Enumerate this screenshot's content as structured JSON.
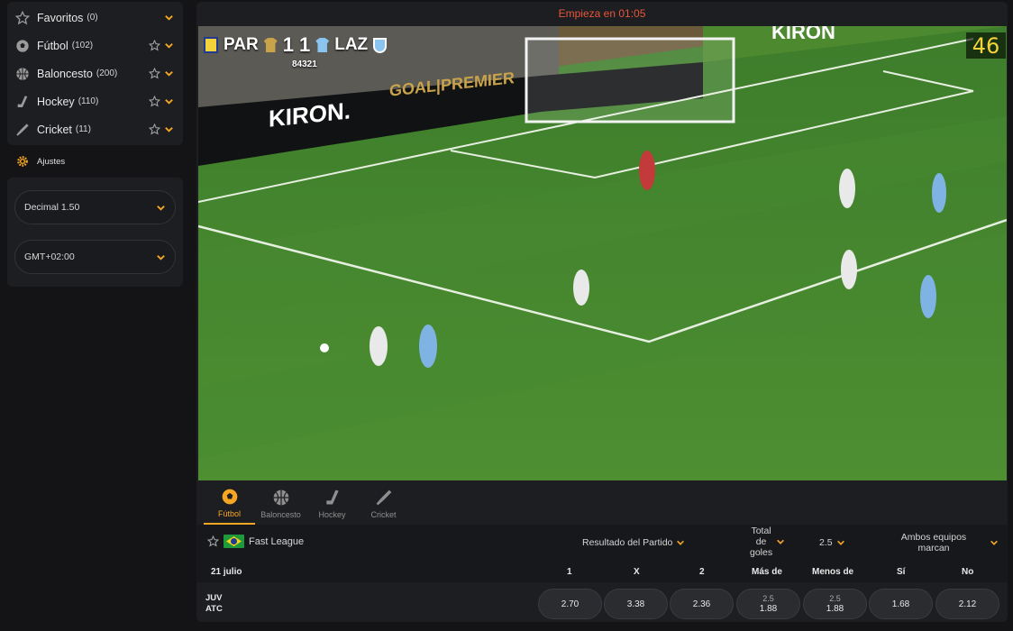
{
  "sidebar": {
    "sports": [
      {
        "name": "Favoritos",
        "count": "(0)",
        "icon": "star-icon",
        "starred": false
      },
      {
        "name": "Fútbol",
        "count": "(102)",
        "icon": "soccer-ball-icon",
        "starred": true
      },
      {
        "name": "Baloncesto",
        "count": "(200)",
        "icon": "basketball-icon",
        "starred": true
      },
      {
        "name": "Hockey",
        "count": "(110)",
        "icon": "hockey-stick-icon",
        "starred": true
      },
      {
        "name": "Cricket",
        "count": "(11)",
        "icon": "cricket-bat-icon",
        "starred": true
      }
    ],
    "settings_label": "Ajustes",
    "odds_format": "Decimal 1.50",
    "timezone": "GMT+02:00"
  },
  "countdown": {
    "prefix": "Empieza en",
    "time": "01:05"
  },
  "video": {
    "home_team": "PAR",
    "away_team": "LAZ",
    "home_score": "1",
    "away_score": "1",
    "match_id": "84321",
    "minute": "46"
  },
  "sport_tabs": [
    {
      "label": "Fútbol",
      "icon": "soccer-ball-icon",
      "active": true
    },
    {
      "label": "Baloncesto",
      "icon": "basketball-icon",
      "active": false
    },
    {
      "label": "Hockey",
      "icon": "hockey-stick-icon",
      "active": false
    },
    {
      "label": "Cricket",
      "icon": "cricket-bat-icon",
      "active": false
    }
  ],
  "market": {
    "league": "Fast League",
    "result_label": "Resultado del Partido",
    "total_label_1": "Total",
    "total_label_2": "de",
    "total_label_3": "goles",
    "total_line": "2.5",
    "btts_label_1": "Ambos equipos",
    "btts_label_2": "marcan"
  },
  "header": {
    "date": "21 julio",
    "col1": "1",
    "colx": "X",
    "col2": "2",
    "over": "Más de",
    "under": "Menos de",
    "yes": "Sí",
    "no": "No"
  },
  "event": {
    "home": "JUV",
    "away": "ATC",
    "odd1": "2.70",
    "oddx": "3.38",
    "odd2": "2.36",
    "over_line": "2.5",
    "over_odd": "1.88",
    "under_line": "2.5",
    "under_odd": "1.88",
    "yes_odd": "1.68",
    "no_odd": "2.12"
  },
  "colors": {
    "accent": "#f5a623",
    "countdown": "#e8553a",
    "minute": "#f4d33a"
  }
}
